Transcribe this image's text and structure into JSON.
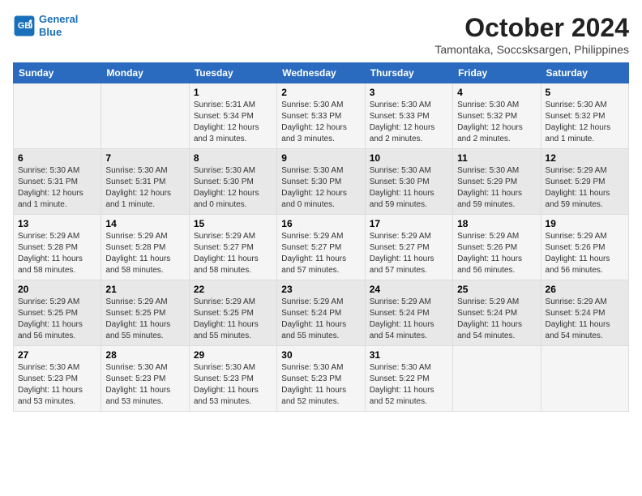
{
  "header": {
    "logo_line1": "General",
    "logo_line2": "Blue",
    "month": "October 2024",
    "location": "Tamontaka, Soccsksargen, Philippines"
  },
  "weekdays": [
    "Sunday",
    "Monday",
    "Tuesday",
    "Wednesday",
    "Thursday",
    "Friday",
    "Saturday"
  ],
  "weeks": [
    [
      {
        "day": "",
        "info": ""
      },
      {
        "day": "",
        "info": ""
      },
      {
        "day": "1",
        "info": "Sunrise: 5:31 AM\nSunset: 5:34 PM\nDaylight: 12 hours\nand 3 minutes."
      },
      {
        "day": "2",
        "info": "Sunrise: 5:30 AM\nSunset: 5:33 PM\nDaylight: 12 hours\nand 3 minutes."
      },
      {
        "day": "3",
        "info": "Sunrise: 5:30 AM\nSunset: 5:33 PM\nDaylight: 12 hours\nand 2 minutes."
      },
      {
        "day": "4",
        "info": "Sunrise: 5:30 AM\nSunset: 5:32 PM\nDaylight: 12 hours\nand 2 minutes."
      },
      {
        "day": "5",
        "info": "Sunrise: 5:30 AM\nSunset: 5:32 PM\nDaylight: 12 hours\nand 1 minute."
      }
    ],
    [
      {
        "day": "6",
        "info": "Sunrise: 5:30 AM\nSunset: 5:31 PM\nDaylight: 12 hours\nand 1 minute."
      },
      {
        "day": "7",
        "info": "Sunrise: 5:30 AM\nSunset: 5:31 PM\nDaylight: 12 hours\nand 1 minute."
      },
      {
        "day": "8",
        "info": "Sunrise: 5:30 AM\nSunset: 5:30 PM\nDaylight: 12 hours\nand 0 minutes."
      },
      {
        "day": "9",
        "info": "Sunrise: 5:30 AM\nSunset: 5:30 PM\nDaylight: 12 hours\nand 0 minutes."
      },
      {
        "day": "10",
        "info": "Sunrise: 5:30 AM\nSunset: 5:30 PM\nDaylight: 11 hours\nand 59 minutes."
      },
      {
        "day": "11",
        "info": "Sunrise: 5:30 AM\nSunset: 5:29 PM\nDaylight: 11 hours\nand 59 minutes."
      },
      {
        "day": "12",
        "info": "Sunrise: 5:29 AM\nSunset: 5:29 PM\nDaylight: 11 hours\nand 59 minutes."
      }
    ],
    [
      {
        "day": "13",
        "info": "Sunrise: 5:29 AM\nSunset: 5:28 PM\nDaylight: 11 hours\nand 58 minutes."
      },
      {
        "day": "14",
        "info": "Sunrise: 5:29 AM\nSunset: 5:28 PM\nDaylight: 11 hours\nand 58 minutes."
      },
      {
        "day": "15",
        "info": "Sunrise: 5:29 AM\nSunset: 5:27 PM\nDaylight: 11 hours\nand 58 minutes."
      },
      {
        "day": "16",
        "info": "Sunrise: 5:29 AM\nSunset: 5:27 PM\nDaylight: 11 hours\nand 57 minutes."
      },
      {
        "day": "17",
        "info": "Sunrise: 5:29 AM\nSunset: 5:27 PM\nDaylight: 11 hours\nand 57 minutes."
      },
      {
        "day": "18",
        "info": "Sunrise: 5:29 AM\nSunset: 5:26 PM\nDaylight: 11 hours\nand 56 minutes."
      },
      {
        "day": "19",
        "info": "Sunrise: 5:29 AM\nSunset: 5:26 PM\nDaylight: 11 hours\nand 56 minutes."
      }
    ],
    [
      {
        "day": "20",
        "info": "Sunrise: 5:29 AM\nSunset: 5:25 PM\nDaylight: 11 hours\nand 56 minutes."
      },
      {
        "day": "21",
        "info": "Sunrise: 5:29 AM\nSunset: 5:25 PM\nDaylight: 11 hours\nand 55 minutes."
      },
      {
        "day": "22",
        "info": "Sunrise: 5:29 AM\nSunset: 5:25 PM\nDaylight: 11 hours\nand 55 minutes."
      },
      {
        "day": "23",
        "info": "Sunrise: 5:29 AM\nSunset: 5:24 PM\nDaylight: 11 hours\nand 55 minutes."
      },
      {
        "day": "24",
        "info": "Sunrise: 5:29 AM\nSunset: 5:24 PM\nDaylight: 11 hours\nand 54 minutes."
      },
      {
        "day": "25",
        "info": "Sunrise: 5:29 AM\nSunset: 5:24 PM\nDaylight: 11 hours\nand 54 minutes."
      },
      {
        "day": "26",
        "info": "Sunrise: 5:29 AM\nSunset: 5:24 PM\nDaylight: 11 hours\nand 54 minutes."
      }
    ],
    [
      {
        "day": "27",
        "info": "Sunrise: 5:30 AM\nSunset: 5:23 PM\nDaylight: 11 hours\nand 53 minutes."
      },
      {
        "day": "28",
        "info": "Sunrise: 5:30 AM\nSunset: 5:23 PM\nDaylight: 11 hours\nand 53 minutes."
      },
      {
        "day": "29",
        "info": "Sunrise: 5:30 AM\nSunset: 5:23 PM\nDaylight: 11 hours\nand 53 minutes."
      },
      {
        "day": "30",
        "info": "Sunrise: 5:30 AM\nSunset: 5:23 PM\nDaylight: 11 hours\nand 52 minutes."
      },
      {
        "day": "31",
        "info": "Sunrise: 5:30 AM\nSunset: 5:22 PM\nDaylight: 11 hours\nand 52 minutes."
      },
      {
        "day": "",
        "info": ""
      },
      {
        "day": "",
        "info": ""
      }
    ]
  ]
}
